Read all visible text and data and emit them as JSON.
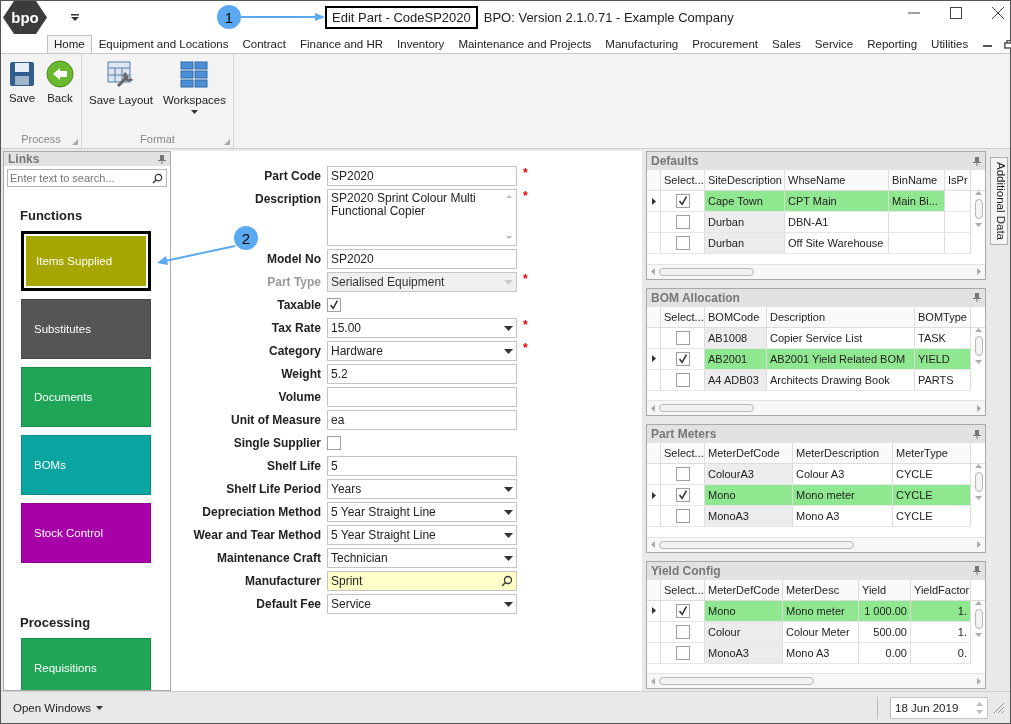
{
  "window": {
    "logo": "bpo",
    "title": "Edit Part - CodeSP2020",
    "app_title": "BPO: Version 2.1.0.71 - Example Company"
  },
  "ribbon_tabs": [
    {
      "label": "Home",
      "selected": true
    },
    {
      "label": "Equipment and Locations",
      "selected": false
    },
    {
      "label": "Contract",
      "selected": false
    },
    {
      "label": "Finance and HR",
      "selected": false
    },
    {
      "label": "Inventory",
      "selected": false
    },
    {
      "label": "Maintenance and Projects",
      "selected": false
    },
    {
      "label": "Manufacturing",
      "selected": false
    },
    {
      "label": "Procurement",
      "selected": false
    },
    {
      "label": "Sales",
      "selected": false
    },
    {
      "label": "Service",
      "selected": false
    },
    {
      "label": "Reporting",
      "selected": false
    },
    {
      "label": "Utilities",
      "selected": false
    }
  ],
  "ribbon_groups": [
    {
      "label": "Process",
      "buttons": [
        {
          "label": "Save",
          "kind": "save"
        },
        {
          "label": "Back",
          "kind": "back"
        }
      ]
    },
    {
      "label": "Format",
      "buttons": [
        {
          "label": "Save Layout",
          "kind": "layout"
        },
        {
          "label": "Workspaces",
          "kind": "workspaces"
        }
      ]
    }
  ],
  "links": {
    "title": "Links",
    "search_placeholder": "Enter text to search...",
    "sections": [
      {
        "heading": "Functions",
        "tiles": [
          {
            "label": "Items Supplied",
            "color": "#a6a600",
            "selected": true
          },
          {
            "label": "Substitutes",
            "color": "#555555",
            "selected": false
          },
          {
            "label": "Documents",
            "color": "#1ea556",
            "selected": false
          },
          {
            "label": "BOMs",
            "color": "#0aa5a0",
            "selected": false
          },
          {
            "label": "Stock Control",
            "color": "#a800a8",
            "selected": false
          }
        ]
      },
      {
        "heading": "Processing",
        "tiles": [
          {
            "label": "Requisitions",
            "color": "#1ea556",
            "selected": false
          }
        ]
      }
    ]
  },
  "form": {
    "required_marker": "*",
    "fields": [
      {
        "label": "Part Code",
        "kind": "text",
        "value": "SP2020",
        "required": true,
        "disabled": false
      },
      {
        "label": "Description",
        "kind": "memo",
        "value": "SP2020 Sprint Colour Multi Functional Copier",
        "required": true,
        "disabled": false
      },
      {
        "label": "Model No",
        "kind": "text",
        "value": "SP2020",
        "required": false,
        "disabled": false
      },
      {
        "label": "Part Type",
        "kind": "combo",
        "value": "Serialised Equipment",
        "required": true,
        "disabled": true
      },
      {
        "label": "Taxable",
        "kind": "checkbox",
        "checked": true,
        "required": false,
        "disabled": false
      },
      {
        "label": "Tax Rate",
        "kind": "combo",
        "value": "15.00",
        "required": true,
        "disabled": false
      },
      {
        "label": "Category",
        "kind": "combo",
        "value": "Hardware",
        "required": true,
        "disabled": false
      },
      {
        "label": "Weight",
        "kind": "text",
        "value": "5.2",
        "required": false,
        "disabled": false
      },
      {
        "label": "Volume",
        "kind": "text",
        "required": false,
        "disabled": false
      },
      {
        "label": "Unit of Measure",
        "kind": "text",
        "value": "ea",
        "required": false,
        "disabled": false
      },
      {
        "label": "Single Supplier",
        "kind": "checkbox",
        "checked": false,
        "required": false,
        "disabled": false
      },
      {
        "label": "Shelf Life",
        "kind": "text",
        "value": "5",
        "required": false,
        "disabled": false
      },
      {
        "label": "Shelf Life Period",
        "kind": "combo",
        "value": "Years",
        "required": false,
        "disabled": false
      },
      {
        "label": "Depreciation Method",
        "kind": "combo",
        "value": "5 Year Straight Line",
        "required": false,
        "disabled": false
      },
      {
        "label": "Wear and Tear Method",
        "kind": "combo",
        "value": "5 Year Straight Line",
        "required": false,
        "disabled": false
      },
      {
        "label": "Maintenance Craft",
        "kind": "combo",
        "value": "Technician",
        "required": false,
        "disabled": false
      },
      {
        "label": "Manufacturer",
        "kind": "lookup",
        "value": "Sprint",
        "required": false,
        "disabled": false
      },
      {
        "label": "Default Fee",
        "kind": "combo",
        "value": "Service",
        "required": false,
        "disabled": false
      }
    ]
  },
  "panels": [
    {
      "title": "Defaults",
      "select_column": "Select...",
      "columns": [
        "SiteDescription",
        "WhseName",
        "BinName",
        "IsPr"
      ],
      "rows": [
        {
          "selected": true,
          "checked": true,
          "cells": [
            "Cape Town",
            "CPT Main",
            "Main Bi..."
          ]
        },
        {
          "selected": false,
          "checked": false,
          "cells": [
            "Durban",
            "DBN-A1"
          ]
        },
        {
          "selected": false,
          "checked": false,
          "cells": [
            "Durban",
            "Off Site Warehouse"
          ]
        }
      ]
    },
    {
      "title": "BOM Allocation",
      "select_column": "Select...",
      "columns": [
        "BOMCode",
        "Description",
        "BOMType"
      ],
      "rows": [
        {
          "selected": false,
          "checked": false,
          "cells": [
            "AB1008",
            "Copier Service List",
            "TASK"
          ]
        },
        {
          "selected": true,
          "checked": true,
          "cells": [
            "AB2001",
            "AB2001 Yield Related BOM",
            "YIELD"
          ]
        },
        {
          "selected": false,
          "checked": false,
          "cells": [
            "A4 ADB03",
            "Architects Drawing Book",
            "PARTS"
          ]
        }
      ]
    },
    {
      "title": "Part Meters",
      "select_column": "Select...",
      "columns": [
        "MeterDefCode",
        "MeterDescription",
        "MeterType"
      ],
      "rows": [
        {
          "selected": false,
          "checked": false,
          "cells": [
            "ColourA3",
            "Colour A3",
            "CYCLE"
          ]
        },
        {
          "selected": true,
          "checked": true,
          "cells": [
            "Mono",
            "Mono meter",
            "CYCLE"
          ]
        },
        {
          "selected": false,
          "checked": false,
          "cells": [
            "MonoA3",
            "Mono A3",
            "CYCLE"
          ]
        }
      ]
    },
    {
      "title": "Yield Config",
      "select_column": "Select...",
      "columns": [
        "MeterDefCode",
        "MeterDesc",
        "Yield",
        "YieldFactor"
      ],
      "rows": [
        {
          "selected": true,
          "checked": true,
          "cells": [
            "Mono",
            "Mono meter",
            "1 000.00",
            "1."
          ]
        },
        {
          "selected": false,
          "checked": false,
          "cells": [
            "Colour",
            "Colour Meter",
            "500.00",
            "1."
          ]
        },
        {
          "selected": false,
          "checked": false,
          "cells": [
            "MonoA3",
            "Mono A3",
            "0.00",
            "0."
          ]
        }
      ]
    }
  ],
  "side_tab": "Additional Data",
  "status_bar": {
    "open_windows": "Open Windows",
    "date": "18 Jun 2019"
  },
  "annotations": [
    {
      "label": "1"
    },
    {
      "label": "2"
    }
  ]
}
